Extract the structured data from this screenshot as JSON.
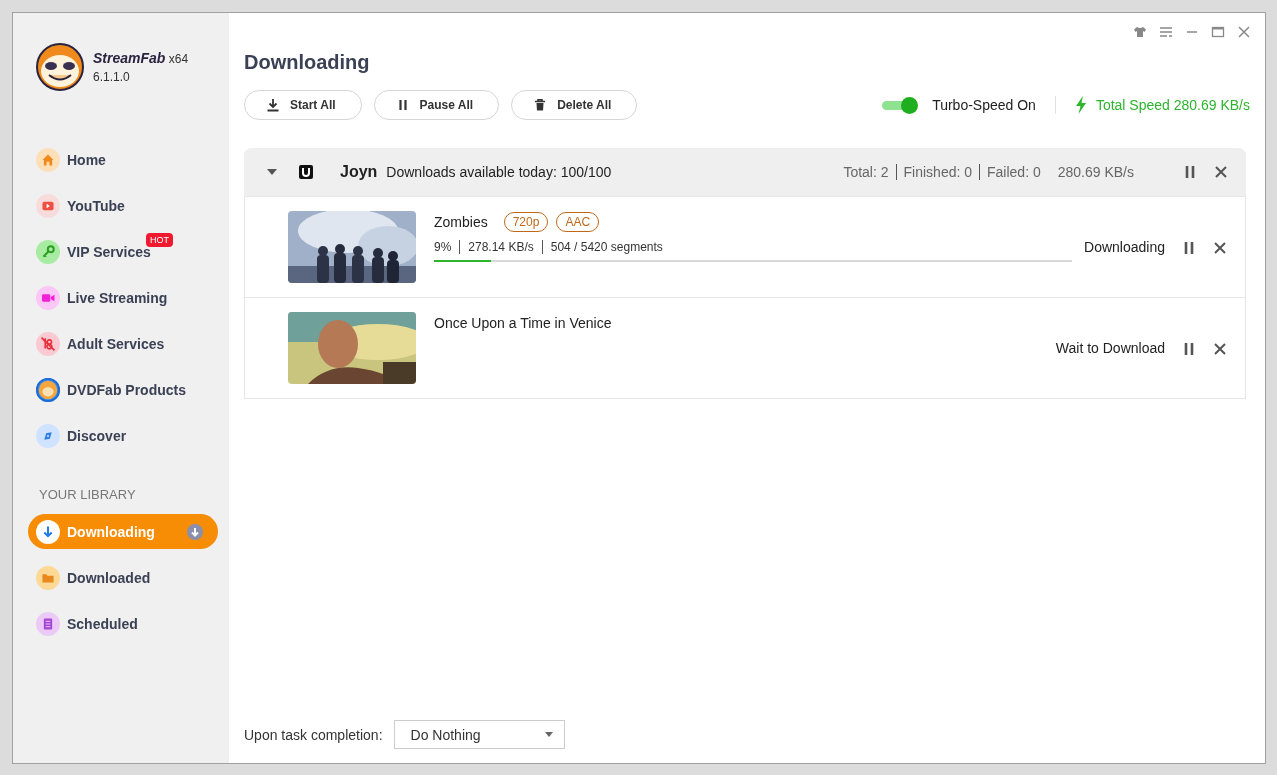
{
  "app": {
    "name": "StreamFab",
    "arch": "x64",
    "version": "6.1.1.0"
  },
  "nav": [
    {
      "label": "Home",
      "kind": "home",
      "selected": false
    },
    {
      "label": "YouTube",
      "kind": "youtube",
      "selected": false
    },
    {
      "label": "VIP Services",
      "kind": "key",
      "selected": false,
      "badge": "HOT"
    },
    {
      "label": "Live Streaming",
      "kind": "camera",
      "selected": false
    },
    {
      "label": "Adult Services",
      "kind": "adult",
      "selected": false
    },
    {
      "label": "DVDFab Products",
      "kind": "mascot",
      "selected": false
    },
    {
      "label": "Discover",
      "kind": "compass",
      "selected": false
    }
  ],
  "library": {
    "heading": "YOUR LIBRARY",
    "items": [
      {
        "label": "Downloading",
        "kind": "download",
        "selected": true
      },
      {
        "label": "Downloaded",
        "kind": "folder",
        "selected": false
      },
      {
        "label": "Scheduled",
        "kind": "list",
        "selected": false
      }
    ]
  },
  "page_title": "Downloading",
  "toolbar": {
    "buttons": [
      {
        "label": "Start All",
        "kind": "download"
      },
      {
        "label": "Pause All",
        "kind": "pause"
      },
      {
        "label": "Delete All",
        "kind": "trash"
      }
    ],
    "turbo": {
      "label": "Turbo-Speed On",
      "on": true
    },
    "total_speed": "Total Speed 280.69 KB/s"
  },
  "group": {
    "expanded": true,
    "name": "Joyn",
    "quota": "Downloads available today: 100/100",
    "stats": [
      "Total: 2",
      "Finished: 0",
      "Failed: 0"
    ],
    "speed": "280.69 KB/s"
  },
  "tasks": [
    {
      "title": "Zombies",
      "tags": [
        "720p",
        "AAC"
      ],
      "percent": "9%",
      "speed": "278.14 KB/s",
      "segments": "504 / 5420 segments",
      "level": 0.09,
      "status": "Downloading"
    },
    {
      "title": "Once Upon a Time in Venice",
      "status": "Wait to Download"
    }
  ],
  "footer": {
    "label": "Upon task completion:",
    "value": "Do Nothing"
  }
}
